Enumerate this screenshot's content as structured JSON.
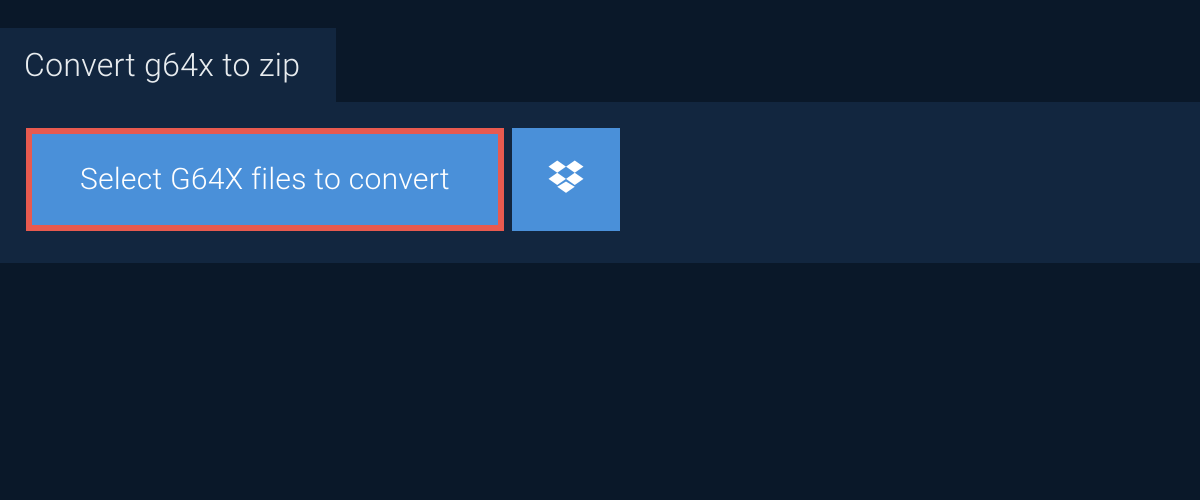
{
  "tab": {
    "title": "Convert g64x to zip"
  },
  "actions": {
    "select_label": "Select G64X files to convert"
  }
}
